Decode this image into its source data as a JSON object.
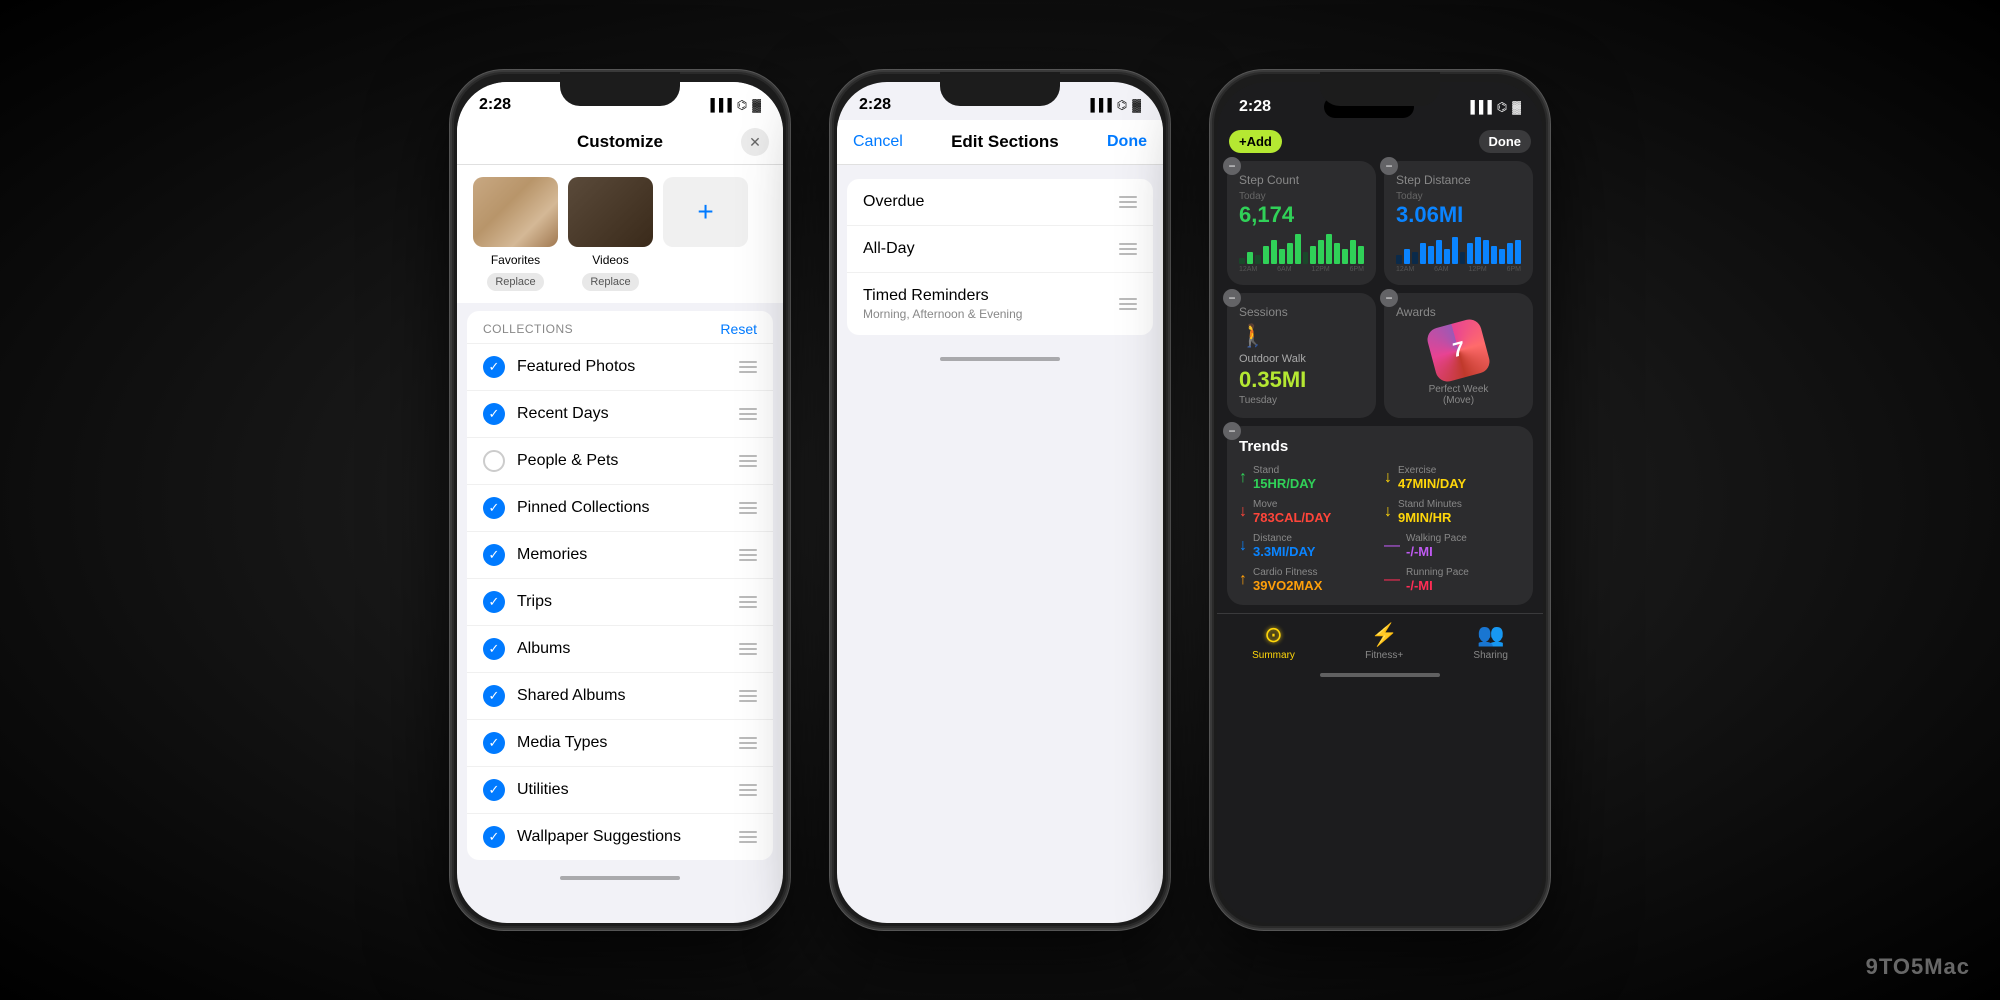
{
  "page": {
    "watermark": "9TO5Mac"
  },
  "phone1": {
    "status": {
      "time": "2:28",
      "signal": "▐▐▐",
      "wifi": "⌬",
      "battery": "▓"
    },
    "header": {
      "title": "Customize",
      "close_label": "✕"
    },
    "albums": [
      {
        "name": "Favorites",
        "type": "favorites",
        "replace_label": "Replace"
      },
      {
        "name": "Videos",
        "type": "videos",
        "replace_label": "Replace"
      },
      {
        "name": "+",
        "type": "add",
        "replace_label": ""
      }
    ],
    "collections_label": "COLLECTIONS",
    "reset_label": "Reset",
    "items": [
      {
        "name": "Featured Photos",
        "checked": true
      },
      {
        "name": "Recent Days",
        "checked": true
      },
      {
        "name": "People & Pets",
        "checked": false
      },
      {
        "name": "Pinned Collections",
        "checked": true
      },
      {
        "name": "Memories",
        "checked": true
      },
      {
        "name": "Trips",
        "checked": true
      },
      {
        "name": "Albums",
        "checked": true
      },
      {
        "name": "Shared Albums",
        "checked": true
      },
      {
        "name": "Media Types",
        "checked": true
      },
      {
        "name": "Utilities",
        "checked": true
      },
      {
        "name": "Wallpaper Suggestions",
        "checked": true
      }
    ]
  },
  "phone2": {
    "status": {
      "time": "2:28"
    },
    "cancel_label": "Cancel",
    "title": "Edit Sections",
    "done_label": "Done",
    "sections": [
      {
        "name": "Overdue",
        "sub": ""
      },
      {
        "name": "All-Day",
        "sub": ""
      },
      {
        "name": "Timed Reminders",
        "sub": "Morning, Afternoon & Evening"
      }
    ]
  },
  "phone3": {
    "status": {
      "time": "2:28"
    },
    "add_label": "+Add",
    "done_label": "Done",
    "cards": [
      {
        "id": "step_count",
        "title": "Step Count",
        "today_label": "Today",
        "value": "6,174",
        "color": "green",
        "bars": [
          2,
          4,
          3,
          6,
          8,
          5,
          7,
          9,
          4,
          6,
          8,
          10,
          7,
          5,
          8,
          6
        ]
      },
      {
        "id": "step_distance",
        "title": "Step Distance",
        "today_label": "Today",
        "value": "3.06MI",
        "color": "blue",
        "bars": [
          3,
          5,
          4,
          7,
          6,
          8,
          5,
          9,
          4,
          7,
          9,
          8,
          6,
          5,
          7,
          8
        ]
      }
    ],
    "sessions": {
      "title": "Sessions",
      "activity": "Outdoor Walk",
      "value": "0.35MI",
      "day": "Tuesday"
    },
    "awards": {
      "title": "Awards",
      "name": "Perfect Week\n(Move)",
      "number": "7"
    },
    "trends": {
      "title": "Trends",
      "items": [
        {
          "label": "Stand",
          "value": "15HR/DAY",
          "arrow": "↑",
          "color": "green"
        },
        {
          "label": "Exercise",
          "value": "47MIN/DAY",
          "arrow": "↓",
          "color": "yellow"
        },
        {
          "label": "Move",
          "value": "783CAL/DAY",
          "arrow": "↓",
          "color": "red"
        },
        {
          "label": "Stand Minutes",
          "value": "9MIN/HR",
          "arrow": "↓",
          "color": "yellow"
        },
        {
          "label": "Distance",
          "value": "3.3MI/DAY",
          "arrow": "↓",
          "color": "blue"
        },
        {
          "label": "Walking Pace",
          "value": "-/-MI",
          "arrow": "—",
          "color": "purple"
        },
        {
          "label": "Cardio Fitness",
          "value": "39VO2MAX",
          "arrow": "↑",
          "color": "orange"
        },
        {
          "label": "Running Pace",
          "value": "-/-MI",
          "arrow": "—",
          "color": "pink"
        }
      ]
    },
    "nav": [
      {
        "icon": "⊙",
        "label": "Summary",
        "active": true
      },
      {
        "icon": "⚡",
        "label": "Fitness+",
        "active": false
      },
      {
        "icon": "👥",
        "label": "Sharing",
        "active": false
      }
    ]
  }
}
